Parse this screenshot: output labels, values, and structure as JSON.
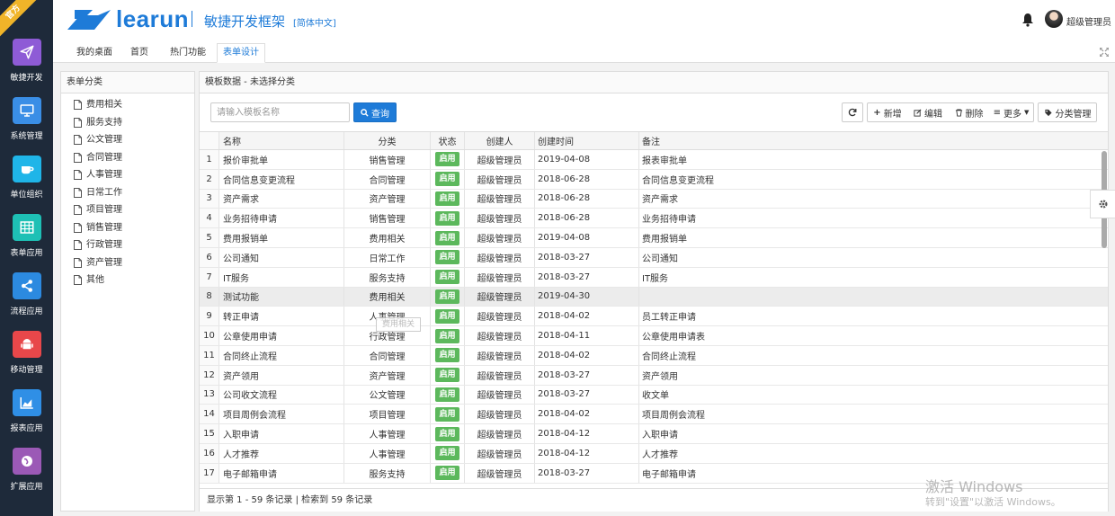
{
  "sidebar": {
    "ribbon": "官方",
    "items": [
      {
        "label": "敏捷开发",
        "icon": "paper-plane-icon",
        "color": "#8e5bd6"
      },
      {
        "label": "系统管理",
        "icon": "monitor-icon",
        "color": "#3a8ee6"
      },
      {
        "label": "单位组织",
        "icon": "coffee-icon",
        "color": "#1fb5e8"
      },
      {
        "label": "表单应用",
        "icon": "table-icon",
        "color": "#1ec0b5"
      },
      {
        "label": "流程应用",
        "icon": "share-icon",
        "color": "#2c8ae0"
      },
      {
        "label": "移动管理",
        "icon": "android-icon",
        "color": "#e8474a"
      },
      {
        "label": "报表应用",
        "icon": "area-chart-icon",
        "color": "#2f8fe6"
      },
      {
        "label": "扩展应用",
        "icon": "globe-icon",
        "color": "#9b59b6"
      }
    ]
  },
  "header": {
    "logo_text": "learun",
    "subtitle": "敏捷开发框架",
    "language": "[简体中文]",
    "user_name": "超级管理员"
  },
  "tabs": [
    {
      "label": "我的桌面",
      "active": false
    },
    {
      "label": "首页",
      "active": false
    },
    {
      "label": "热门功能",
      "active": false
    },
    {
      "label": "表单设计",
      "active": true
    }
  ],
  "category_panel": {
    "title": "表单分类",
    "items": [
      "费用相关",
      "服务支持",
      "公文管理",
      "合同管理",
      "人事管理",
      "日常工作",
      "项目管理",
      "销售管理",
      "行政管理",
      "资产管理",
      "其他"
    ]
  },
  "main_panel": {
    "title": "模板数据 - 未选择分类",
    "search": {
      "placeholder": "请输入模板名称",
      "value": ""
    },
    "query_label": "查询",
    "toolbar": {
      "refresh_icon": "refresh-icon",
      "add_label": "新增",
      "edit_label": "编辑",
      "delete_label": "删除",
      "more_label": "更多",
      "category_manage_label": "分类管理"
    },
    "columns": {
      "name": "名称",
      "category": "分类",
      "status": "状态",
      "creator": "创建人",
      "created_time": "创建时间",
      "note": "备注"
    },
    "rows": [
      {
        "idx": "1",
        "name": "报价审批单",
        "category": "销售管理",
        "status": "启用",
        "creator": "超级管理员",
        "time": "2019-04-08",
        "note": "报表审批单"
      },
      {
        "idx": "2",
        "name": "合同信息变更流程",
        "category": "合同管理",
        "status": "启用",
        "creator": "超级管理员",
        "time": "2018-06-28",
        "note": "合同信息变更流程"
      },
      {
        "idx": "3",
        "name": "资产需求",
        "category": "资产管理",
        "status": "启用",
        "creator": "超级管理员",
        "time": "2018-06-28",
        "note": "资产需求"
      },
      {
        "idx": "4",
        "name": "业务招待申请",
        "category": "销售管理",
        "status": "启用",
        "creator": "超级管理员",
        "time": "2018-06-28",
        "note": "业务招待申请"
      },
      {
        "idx": "5",
        "name": "费用报销单",
        "category": "费用相关",
        "status": "启用",
        "creator": "超级管理员",
        "time": "2019-04-08",
        "note": "费用报销单"
      },
      {
        "idx": "6",
        "name": "公司通知",
        "category": "日常工作",
        "status": "启用",
        "creator": "超级管理员",
        "time": "2018-03-27",
        "note": "公司通知"
      },
      {
        "idx": "7",
        "name": "IT服务",
        "category": "服务支持",
        "status": "启用",
        "creator": "超级管理员",
        "time": "2018-03-27",
        "note": "IT服务"
      },
      {
        "idx": "8",
        "name": "测试功能",
        "category": "费用相关",
        "status": "启用",
        "creator": "超级管理员",
        "time": "2019-04-30",
        "note": ""
      },
      {
        "idx": "9",
        "name": "转正申请",
        "category": "人事管理",
        "status": "启用",
        "creator": "超级管理员",
        "time": "2018-04-02",
        "note": "员工转正申请"
      },
      {
        "idx": "10",
        "name": "公章使用申请",
        "category": "行政管理",
        "status": "启用",
        "creator": "超级管理员",
        "time": "2018-04-11",
        "note": "公章使用申请表"
      },
      {
        "idx": "11",
        "name": "合同终止流程",
        "category": "合同管理",
        "status": "启用",
        "creator": "超级管理员",
        "time": "2018-04-02",
        "note": "合同终止流程"
      },
      {
        "idx": "12",
        "name": "资产领用",
        "category": "资产管理",
        "status": "启用",
        "creator": "超级管理员",
        "time": "2018-03-27",
        "note": "资产领用"
      },
      {
        "idx": "13",
        "name": "公司收文流程",
        "category": "公文管理",
        "status": "启用",
        "creator": "超级管理员",
        "time": "2018-03-27",
        "note": "收文单"
      },
      {
        "idx": "14",
        "name": "项目周例会流程",
        "category": "项目管理",
        "status": "启用",
        "creator": "超级管理员",
        "time": "2018-04-02",
        "note": "项目周例会流程"
      },
      {
        "idx": "15",
        "name": "入职申请",
        "category": "人事管理",
        "status": "启用",
        "creator": "超级管理员",
        "time": "2018-04-12",
        "note": "入职申请"
      },
      {
        "idx": "16",
        "name": "人才推荐",
        "category": "人事管理",
        "status": "启用",
        "creator": "超级管理员",
        "time": "2018-04-12",
        "note": "人才推荐"
      },
      {
        "idx": "17",
        "name": "电子邮箱申请",
        "category": "服务支持",
        "status": "启用",
        "creator": "超级管理员",
        "time": "2018-03-27",
        "note": "电子邮箱申请"
      }
    ],
    "highlighted_row": 8,
    "drag_ghost_label": "费用相关",
    "footer_text": "显示第 1 - 59 条记录 | 检索到 59 条记录"
  },
  "watermark": {
    "line1": "激活 Windows",
    "line2": "转到\"设置\"以激活 Windows。"
  },
  "colors": {
    "brand_blue": "#1e7bd8",
    "sidebar_bg": "#1e2a3a",
    "status_green": "#5cb85c"
  }
}
